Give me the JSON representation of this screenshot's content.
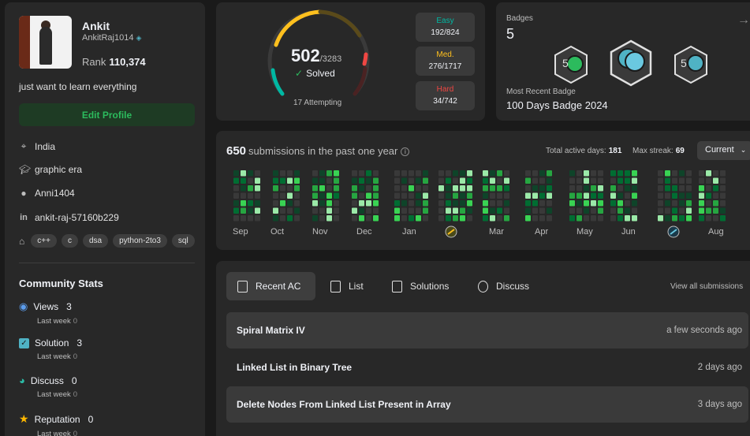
{
  "profile": {
    "name": "Ankit",
    "handle": "AnkitRaj1014",
    "rank_label": "Rank",
    "rank_value": "110,374",
    "bio": "just want to learn everything",
    "edit_label": "Edit Profile",
    "location": "India",
    "school": "graphic era",
    "github": "Anni1404",
    "linkedin": "ankit-raj-57160b229",
    "skills": [
      "c++",
      "c",
      "dsa",
      "python-2to3",
      "sql"
    ]
  },
  "community": {
    "title": "Community Stats",
    "last_week_label": "Last week",
    "items": [
      {
        "label": "Views",
        "value": "3",
        "last_week": "0",
        "color": "#5c9ded"
      },
      {
        "label": "Solution",
        "value": "3",
        "last_week": "0",
        "color": "#4fb2c4"
      },
      {
        "label": "Discuss",
        "value": "0",
        "last_week": "0",
        "color": "#2cbba6"
      },
      {
        "label": "Reputation",
        "value": "0",
        "last_week": "0",
        "color": "#ffb800"
      }
    ]
  },
  "solved": {
    "count": "502",
    "total": "/3283",
    "label": "Solved",
    "attempting": "17 Attempting",
    "easy": {
      "label": "Easy",
      "value": "192/824",
      "color": "#00b8a3"
    },
    "medium": {
      "label": "Med.",
      "value": "276/1717",
      "color": "#ffc01e"
    },
    "hard": {
      "label": "Hard",
      "value": "34/742",
      "color": "#ef4743"
    }
  },
  "badges": {
    "title": "Badges",
    "count": "5",
    "recent_label": "Most Recent Badge",
    "recent_name": "100 Days Badge 2024",
    "arrow": "→"
  },
  "submissions": {
    "count": "650",
    "label": "submissions in the past one year",
    "active_label": "Total active days:",
    "active_value": "181",
    "streak_label": "Max streak:",
    "streak_value": "69",
    "period": "Current",
    "months": [
      "Sep",
      "Oct",
      "Nov",
      "Dec",
      "Jan",
      "Mar",
      "Apr",
      "May",
      "Jun",
      "Aug"
    ]
  },
  "recent": {
    "tabs": [
      "Recent AC",
      "List",
      "Solutions",
      "Discuss"
    ],
    "view_all": "View all submissions",
    "items": [
      {
        "title": "Spiral Matrix IV",
        "time": "a few seconds ago"
      },
      {
        "title": "Linked List in Binary Tree",
        "time": "2 days ago"
      },
      {
        "title": "Delete Nodes From Linked List Present in Array",
        "time": "3 days ago"
      }
    ]
  }
}
